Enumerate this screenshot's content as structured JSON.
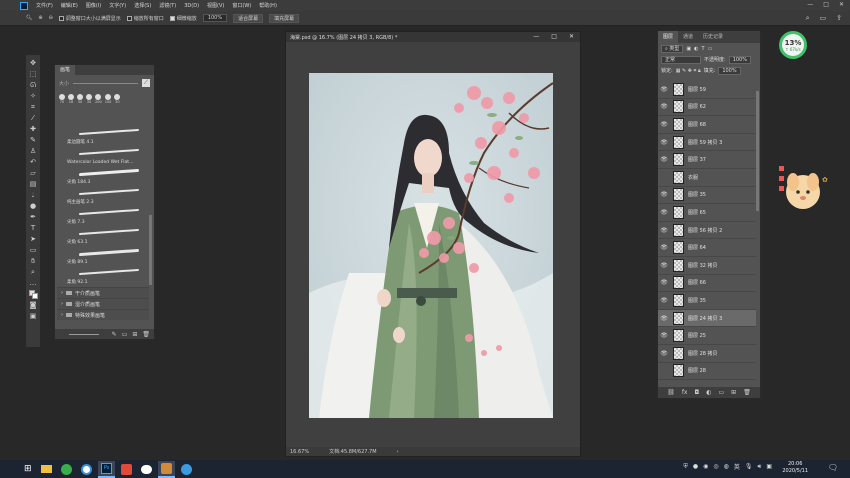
{
  "menubar": {
    "items": [
      "文件(F)",
      "编辑(E)",
      "图像(I)",
      "文字(Y)",
      "选择(S)",
      "滤镜(T)",
      "3D(D)",
      "视图(V)",
      "窗口(W)",
      "帮助(H)"
    ],
    "window_controls": [
      "—",
      "□",
      "✕"
    ]
  },
  "options": {
    "resize_windows_label": "调整窗口大小以满屏显示",
    "zoom_all_label": "缩放所有窗口",
    "scrubby_zoom_label": "细微缩放",
    "zoom_value": "100%",
    "fit_screen_label": "适合屏幕",
    "fill_screen_label": "填充屏幕"
  },
  "brushes": {
    "tab": "画笔",
    "size_label": "大小",
    "tip_sizes": [
      "70",
      "18",
      "30",
      "30",
      "200",
      "100",
      "30"
    ],
    "list": [
      "柔边圆笔 4.1",
      "Watercolor Loaded Wet Flat...",
      "尖角 184.3",
      "纯主画笔 2.3",
      "尖角 7.3",
      "尖角 63.1",
      "尖角 89.1",
      "柔角 92.1"
    ],
    "folders": [
      "干介质画笔",
      "湿介质画笔",
      "特殊效果画笔"
    ]
  },
  "document": {
    "title": "海棠.psd @ 16.7% (图层 24 拷贝 3, RGB/8) *",
    "zoom": "16.67%",
    "doc_info": "文档:45.8M/627.7M"
  },
  "layers": {
    "tabs": [
      "图层",
      "通道",
      "历史记录"
    ],
    "filter_label": "类型",
    "blend_mode": "正常",
    "opacity_label": "不透明度:",
    "opacity_value": "100%",
    "lock_label": "锁定:",
    "fill_label": "填充:",
    "fill_value": "100%",
    "list": [
      {
        "name": "图层 59",
        "visible": true
      },
      {
        "name": "图层 62",
        "visible": true
      },
      {
        "name": "图层 68",
        "visible": true
      },
      {
        "name": "图层 59 拷贝 3",
        "visible": true
      },
      {
        "name": "图层 37",
        "visible": true
      },
      {
        "name": "衣服",
        "visible": false
      },
      {
        "name": "图层 35",
        "visible": true
      },
      {
        "name": "图层 65",
        "visible": true
      },
      {
        "name": "图层 56 拷贝 2",
        "visible": true
      },
      {
        "name": "图层 64",
        "visible": true
      },
      {
        "name": "图层 32 拷贝",
        "visible": true
      },
      {
        "name": "图层 66",
        "visible": true
      },
      {
        "name": "图层 35",
        "visible": true
      },
      {
        "name": "图层 24 拷贝 3",
        "visible": true,
        "selected": true
      },
      {
        "name": "图层 25",
        "visible": true
      },
      {
        "name": "图层 28 拷贝",
        "visible": true
      },
      {
        "name": "图层 28",
        "visible": false
      }
    ]
  },
  "badge": {
    "percent": "13%",
    "sub": "↑ 67k/s"
  },
  "taskbar": {
    "icons": [
      "file-explorer",
      "browser-360",
      "ie-browser",
      "photoshop",
      "wps",
      "wechat",
      "bear-app",
      "app-blue"
    ],
    "time": "20:06",
    "date": "2020/5/11"
  },
  "colors": {
    "accent": "#31a8ff",
    "canvas_bg": "#c9d6db",
    "panel": "#535353",
    "badge_ring": "#3ec36a"
  }
}
